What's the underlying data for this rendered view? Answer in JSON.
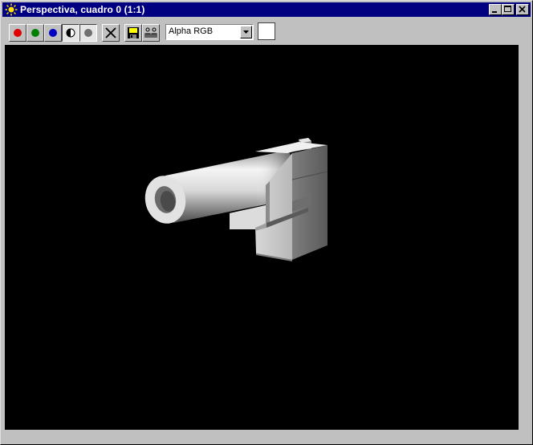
{
  "window": {
    "title": "Perspectiva, cuadro 0 (1:1)",
    "controls": [
      "minimize",
      "maximize",
      "close"
    ]
  },
  "toolbar": {
    "channels": [
      {
        "name": "red-channel",
        "color": "#e00000"
      },
      {
        "name": "green-channel",
        "color": "#008000"
      },
      {
        "name": "blue-channel",
        "color": "#0000c0"
      },
      {
        "name": "alpha-channel",
        "color": "#000000"
      },
      {
        "name": "mono-channel",
        "color": "#707070"
      }
    ],
    "channel_select": {
      "value": "Alpha RGB"
    },
    "swatch_color": "#ffffff"
  },
  "viewport": {
    "background": "#000000",
    "content": "rendered-pistol"
  }
}
